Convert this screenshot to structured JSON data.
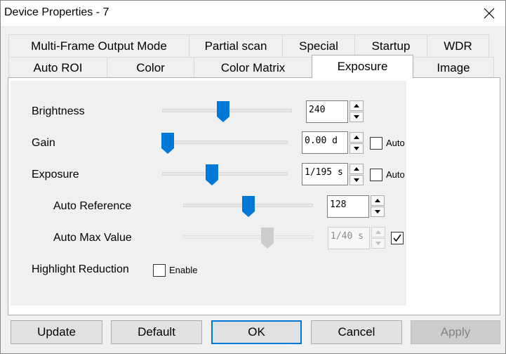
{
  "window": {
    "title": "Device Properties - 7"
  },
  "tabs": {
    "row1": [
      "Multi-Frame Output Mode",
      "Partial scan",
      "Special",
      "Startup",
      "WDR"
    ],
    "row2": [
      "Auto ROI",
      "Color",
      "Color Matrix",
      "Exposure",
      "Image"
    ],
    "active": "Exposure"
  },
  "controls": {
    "brightness": {
      "label": "Brightness",
      "value": "240",
      "slider_fraction": 0.47
    },
    "gain": {
      "label": "Gain",
      "value": "0.00 d",
      "slider_fraction": 0.0,
      "auto_label": "Auto",
      "auto_checked": false
    },
    "exposure": {
      "label": "Exposure",
      "value": "1/195 s",
      "slider_fraction": 0.4,
      "auto_label": "Auto",
      "auto_checked": false
    },
    "auto_reference": {
      "label": "Auto Reference",
      "value": "128",
      "slider_fraction": 0.5
    },
    "auto_max_value": {
      "label": "Auto Max Value",
      "value": "1/40 s",
      "slider_fraction": 0.65,
      "checked": true,
      "disabled": true
    },
    "highlight_reduction": {
      "label": "Highlight Reduction",
      "enable_label": "Enable",
      "checked": false
    }
  },
  "buttons": {
    "update": "Update",
    "default": "Default",
    "ok": "OK",
    "cancel": "Cancel",
    "apply": "Apply"
  },
  "colors": {
    "accent": "#0078d7",
    "disabled": "#cccccc"
  }
}
